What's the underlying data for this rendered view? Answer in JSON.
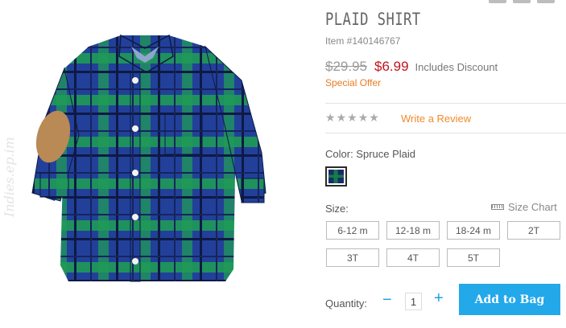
{
  "product": {
    "title": "PLAID SHIRT",
    "item_number": "Item #140146767",
    "original_price": "$29.95",
    "sale_price": "$6.99",
    "discount_note": "Includes Discount",
    "special_offer": "Special Offer",
    "image_alt": "Plaid button-down shirt with elbow patches"
  },
  "reviews": {
    "stars": [
      "★",
      "★",
      "★",
      "★",
      "★"
    ],
    "rating": 0,
    "write_review": "Write a Review"
  },
  "color": {
    "label": "Color: Spruce Plaid",
    "swatch_name": "Spruce Plaid"
  },
  "size": {
    "label": "Size:",
    "chart_link": "Size Chart",
    "options": [
      "6-12 m",
      "12-18 m",
      "18-24 m",
      "2T",
      "3T",
      "4T",
      "5T"
    ]
  },
  "quantity": {
    "label": "Quantity:",
    "minus": "−",
    "value": "1",
    "plus": "+"
  },
  "actions": {
    "add_to_bag": "Add to Bag"
  },
  "watermark": "Indies.ep.im",
  "colors": {
    "sale_red": "#c0141c",
    "offer_orange": "#ea7c22",
    "accent_blue": "#23a8ea",
    "plaid_green": "#1d8a4c",
    "plaid_blue": "#1f3a8f"
  }
}
